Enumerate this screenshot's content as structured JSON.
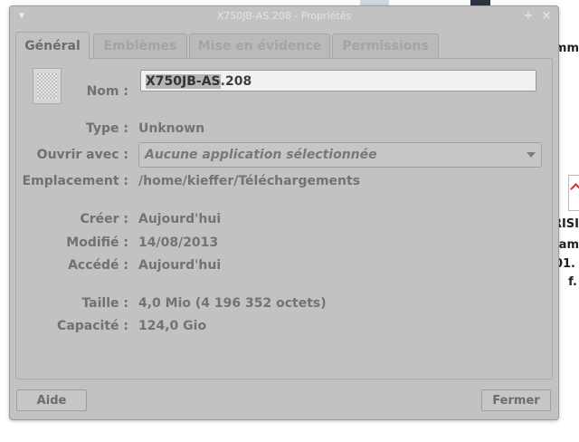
{
  "window": {
    "title": "X750JB-AS.208 - Propriétés",
    "menu_glyph": "▾",
    "pin_glyph": "+",
    "close_glyph": "×"
  },
  "tabs": [
    {
      "label": "Général",
      "active": true
    },
    {
      "label": "Emblèmes",
      "active": false
    },
    {
      "label": "Mise en évidence",
      "active": false
    },
    {
      "label": "Permissions",
      "active": false
    }
  ],
  "general": {
    "name_label": "Nom :",
    "name_value_selected": "X750JB-AS",
    "name_value_rest": ".208",
    "type_label": "Type :",
    "type_value": "Unknown",
    "open_with_label": "Ouvrir avec :",
    "open_with_value": "Aucune application sélectionnée",
    "location_label": "Emplacement :",
    "location_value": "/home/kieffer/Téléchargements",
    "created_label": "Créer :",
    "created_value": "Aujourd'hui",
    "modified_label": "Modifié :",
    "modified_value": "14/08/2013",
    "accessed_label": "Accédé :",
    "accessed_value": "Aujourd'hui",
    "size_label": "Taille :",
    "size_value": "4,0 Mio (4 196 352 octets)",
    "capacity_label": "Capacité :",
    "capacity_value": "124,0 Gio"
  },
  "buttons": {
    "help": "Aide",
    "close": "Fermer"
  },
  "background": {
    "line1": "mm",
    "line2": "RISI",
    "line3": "dam",
    "line4": "01.",
    "line5": "f."
  },
  "colors": {
    "dialog_bg": "#c2c2c2",
    "text_label": "#717171",
    "text_value": "#737373"
  }
}
